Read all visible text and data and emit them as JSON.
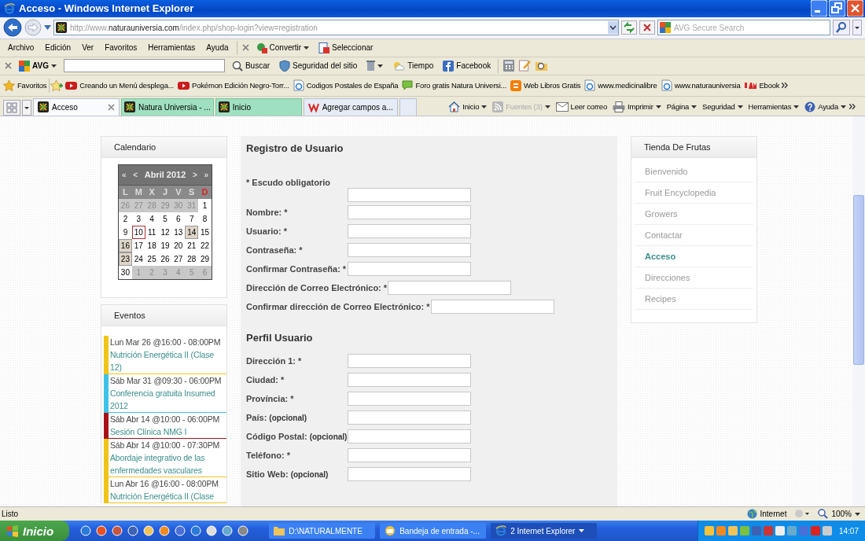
{
  "window": {
    "title": "Acceso - Windows Internet Explorer"
  },
  "address": {
    "url_prefix": "http://www.",
    "url_domain": "naturauniversia.com",
    "url_path": "/index.php/shop-login?view=registration"
  },
  "search": {
    "placeholder": "AVG Secure Search"
  },
  "menu": [
    "Archivo",
    "Edición",
    "Ver",
    "Favoritos",
    "Herramientas",
    "Ayuda"
  ],
  "convert_bar": [
    "Convertir",
    "Seleccionar"
  ],
  "avg_toolbar": {
    "brand": "AVG",
    "buttons": [
      {
        "label": "Buscar",
        "kind": "search"
      },
      {
        "label": "Seguridad del sitio",
        "kind": "shield"
      },
      {
        "label": "Tiempo",
        "kind": "weather"
      },
      {
        "label": "Facebook",
        "kind": "facebook"
      }
    ]
  },
  "favorites": {
    "label": "Favoritos",
    "links": [
      {
        "label": "Creando un Menú desplega...",
        "kind": "video"
      },
      {
        "label": "Pokémon Edición Negro-Torr...",
        "kind": "video"
      },
      {
        "label": "Codigos Postales de España",
        "kind": "page"
      },
      {
        "label": "Foro gratis  Natura Universi...",
        "kind": "chat"
      },
      {
        "label": "Web Libros Gratis",
        "kind": "blog"
      },
      {
        "label": "www.medicinalibre",
        "kind": "page"
      },
      {
        "label": "www.naturauniversia",
        "kind": "page"
      },
      {
        "label": "Ebook",
        "kind": "jam"
      }
    ]
  },
  "tabs": [
    {
      "label": "Acceso",
      "selected": true,
      "grouped": false
    },
    {
      "label": "Natura Universia - ...",
      "selected": false,
      "grouped": true
    },
    {
      "label": "Inicio",
      "selected": false,
      "grouped": true
    },
    {
      "label": "Agregar campos a...",
      "selected": false,
      "grouped": false
    }
  ],
  "command_bar": [
    {
      "label": "Inicio",
      "kind": "home",
      "disabled": false,
      "dropdown": true
    },
    {
      "label": "Fuentes (3)",
      "kind": "feed",
      "disabled": true,
      "dropdown": true
    },
    {
      "label": "Leer correo",
      "kind": "mail",
      "disabled": false,
      "dropdown": false
    },
    {
      "label": "Imprimir",
      "kind": "print",
      "disabled": false,
      "dropdown": true
    },
    {
      "label": "Página",
      "kind": "text",
      "disabled": false,
      "dropdown": true
    },
    {
      "label": "Seguridad",
      "kind": "text",
      "disabled": false,
      "dropdown": true
    },
    {
      "label": "Herramientas",
      "kind": "text",
      "disabled": false,
      "dropdown": true
    },
    {
      "label": "Ayuda",
      "kind": "help",
      "disabled": false,
      "dropdown": true
    }
  ],
  "calendar": {
    "title": "Calendario",
    "nav": [
      "«",
      "<",
      "Abril 2012",
      ">",
      "»"
    ],
    "weekdays": [
      {
        "label": "L",
        "holiday": false
      },
      {
        "label": "M",
        "holiday": false
      },
      {
        "label": "X",
        "holiday": false
      },
      {
        "label": "J",
        "holiday": false
      },
      {
        "label": "V",
        "holiday": false
      },
      {
        "label": "S",
        "holiday": false
      },
      {
        "label": "D",
        "holiday": true
      }
    ],
    "weeks": [
      [
        {
          "day": "26",
          "kind": "other"
        },
        {
          "day": "27",
          "kind": "other"
        },
        {
          "day": "28",
          "kind": "other"
        },
        {
          "day": "29",
          "kind": "other"
        },
        {
          "day": "30",
          "kind": "other"
        },
        {
          "day": "31",
          "kind": "other"
        },
        {
          "day": "1",
          "kind": "day"
        }
      ],
      [
        {
          "day": "2",
          "kind": "day"
        },
        {
          "day": "3",
          "kind": "day"
        },
        {
          "day": "4",
          "kind": "day"
        },
        {
          "day": "5",
          "kind": "day"
        },
        {
          "day": "6",
          "kind": "day"
        },
        {
          "day": "7",
          "kind": "day"
        },
        {
          "day": "8",
          "kind": "day"
        }
      ],
      [
        {
          "day": "9",
          "kind": "day"
        },
        {
          "day": "10",
          "kind": "today"
        },
        {
          "day": "11",
          "kind": "day"
        },
        {
          "day": "12",
          "kind": "day"
        },
        {
          "day": "13",
          "kind": "day"
        },
        {
          "day": "14",
          "kind": "event"
        },
        {
          "day": "15",
          "kind": "day"
        }
      ],
      [
        {
          "day": "16",
          "kind": "event"
        },
        {
          "day": "17",
          "kind": "day"
        },
        {
          "day": "18",
          "kind": "day"
        },
        {
          "day": "19",
          "kind": "day"
        },
        {
          "day": "20",
          "kind": "day"
        },
        {
          "day": "21",
          "kind": "day"
        },
        {
          "day": "22",
          "kind": "day"
        }
      ],
      [
        {
          "day": "23",
          "kind": "event"
        },
        {
          "day": "24",
          "kind": "day"
        },
        {
          "day": "25",
          "kind": "day"
        },
        {
          "day": "26",
          "kind": "day"
        },
        {
          "day": "27",
          "kind": "day"
        },
        {
          "day": "28",
          "kind": "day"
        },
        {
          "day": "29",
          "kind": "day"
        }
      ],
      [
        {
          "day": "30",
          "kind": "day"
        },
        {
          "day": "1",
          "kind": "other"
        },
        {
          "day": "2",
          "kind": "other"
        },
        {
          "day": "3",
          "kind": "other"
        },
        {
          "day": "4",
          "kind": "other"
        },
        {
          "day": "5",
          "kind": "other"
        },
        {
          "day": "6",
          "kind": "other"
        }
      ]
    ]
  },
  "events": {
    "title": "Eventos",
    "items": [
      {
        "date": "Lun Mar 26 @16:00 - 08:00PM",
        "title": "Nutrición Energética II (Clase 12)",
        "color": "#f0c419"
      },
      {
        "date": "Sáb Mar 31 @09:30 - 06:00PM",
        "title": "Conferencia gratuita Insumed 2012",
        "color": "#3ec3e8"
      },
      {
        "date": "Sáb Abr 14 @10:00 - 06:00PM",
        "title": "Sesión Clínica NMG I",
        "color": "#a8101a"
      },
      {
        "date": "Sáb Abr 14 @10:00 - 07:30PM",
        "title": "Abordaje integrativo de las enfermedades vasculares",
        "color": "#f0c419"
      },
      {
        "date": "Lun Abr 16 @16:00 - 08:00PM",
        "title": "Nutrición Energética II (Clase",
        "color": "#f0c419"
      }
    ]
  },
  "form": {
    "title": "Registro de Usuario",
    "note": "* Escudo obligatorio",
    "sections": [
      {
        "blank_first_field": true,
        "fields": [
          {
            "label": "Nombre: *"
          },
          {
            "label": "Usuario: *"
          },
          {
            "label": "Contraseña: *"
          },
          {
            "label": "Confirmar Contraseña: *"
          },
          {
            "label": "Dirección de Correo Electrónico: *"
          },
          {
            "label": "Confirmar dirección de Correo Electrónico: *"
          }
        ]
      },
      {
        "title": "Perfil Usuario",
        "fields": [
          {
            "label": "Dirección 1: *"
          },
          {
            "label": "Ciudad: *"
          },
          {
            "label": "Província: *"
          },
          {
            "label": "País:",
            "hint": "(opcional)"
          },
          {
            "label": "Código Postal:",
            "hint": "(opcional)"
          },
          {
            "label": "Teléfono: *"
          },
          {
            "label": "Sitio Web:",
            "hint": "(opcional)"
          }
        ]
      }
    ]
  },
  "shop_menu": {
    "title": "Tienda De Frutas",
    "items": [
      {
        "label": "Bienvenido",
        "selected": false
      },
      {
        "label": "Fruit Encyclopedia",
        "selected": false
      },
      {
        "label": "Growers",
        "selected": false
      },
      {
        "label": "Contactar",
        "selected": false
      },
      {
        "label": "Acceso",
        "selected": true
      },
      {
        "label": "Direcciones",
        "selected": false
      },
      {
        "label": "Recipes",
        "selected": false
      }
    ]
  },
  "status_bar": {
    "text": "Listo",
    "zone": "Internet",
    "zoom": "100%"
  },
  "taskbar": {
    "start": "Inicio",
    "windows": [
      "D:\\NATURALMENTE",
      "Bandeja de entrada -...",
      "2 Internet Explorer"
    ],
    "clock": "14:07"
  }
}
